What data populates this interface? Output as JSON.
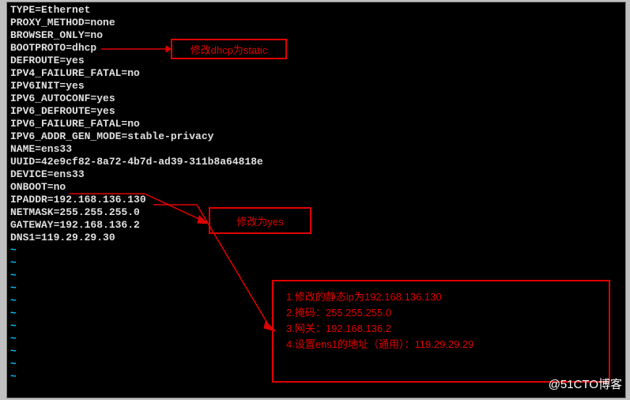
{
  "config_lines": [
    "TYPE=Ethernet",
    "PROXY_METHOD=none",
    "BROWSER_ONLY=no",
    "BOOTPROTO=dhcp",
    "DEFROUTE=yes",
    "IPV4_FAILURE_FATAL=no",
    "IPV6INIT=yes",
    "IPV6_AUTOCONF=yes",
    "IPV6_DEFROUTE=yes",
    "IPV6_FAILURE_FATAL=no",
    "IPV6_ADDR_GEN_MODE=stable-privacy",
    "NAME=ens33",
    "UUID=42e9cf82-8a72-4b7d-ad39-311b8a64818e",
    "DEVICE=ens33",
    "ONBOOT=no",
    "IPADDR=192.168.136.130",
    "NETMASK=255.255.255.0",
    "GATEWAY=192.168.136.2",
    "DNS1=119.29.29.30"
  ],
  "tilde_count": 11,
  "annotation": {
    "box1": "修改dhcp为static",
    "box2": "修改为yes",
    "box3": {
      "line1": "1.修改的静态ip为192.168.136.130",
      "line2": "2.掩码：255.255.255.0",
      "line3": "3.网关：192.168.136.2",
      "line4": "4.设置ens1的地址（通用）：119.29.29.29"
    }
  },
  "watermark": "@51CTO博客"
}
